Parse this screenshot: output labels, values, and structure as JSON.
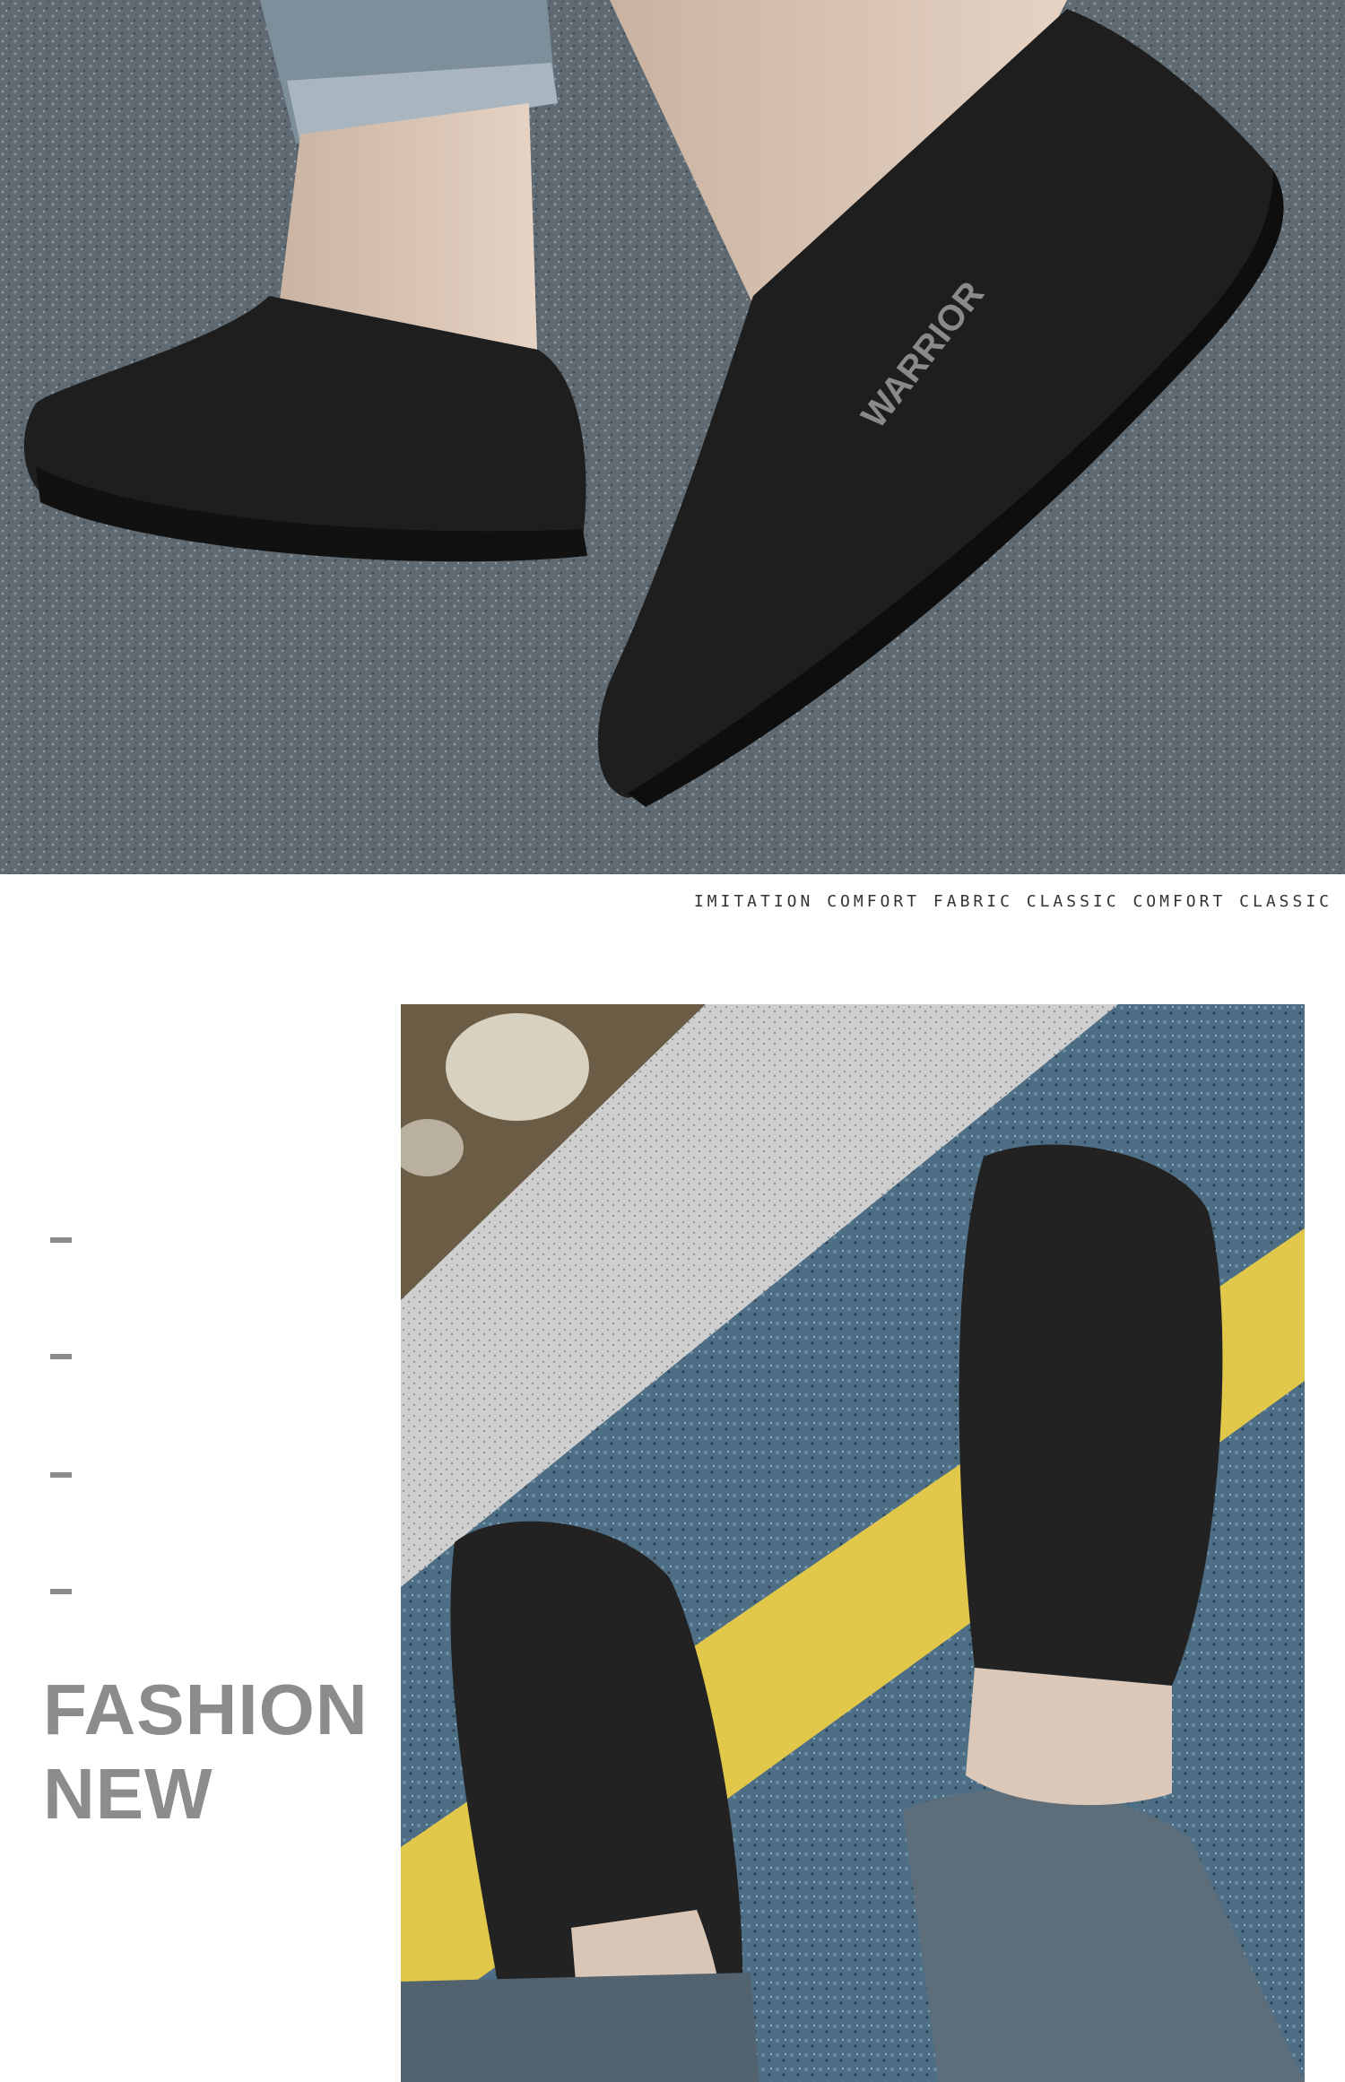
{
  "hero": {
    "brand_text": "WARRIOR",
    "image": "hero-photo-slip-on-shoes-on-asphalt"
  },
  "caption": "IMITATION COMFORT FABRIC CLASSIC COMFORT CLASSIC",
  "side": {
    "dash_count": 4,
    "headline_line1": "FASHION",
    "headline_line2": "NEW"
  },
  "detail_photo": {
    "image": "top-down-photo-shoes-on-road-with-yellow-line"
  },
  "colors": {
    "asphalt": "#5f6a72",
    "shoe": "#1e1e1e",
    "headline": "#8c8c8c",
    "road_yellow": "#e2c84a",
    "curb": "#cfcfcf"
  }
}
